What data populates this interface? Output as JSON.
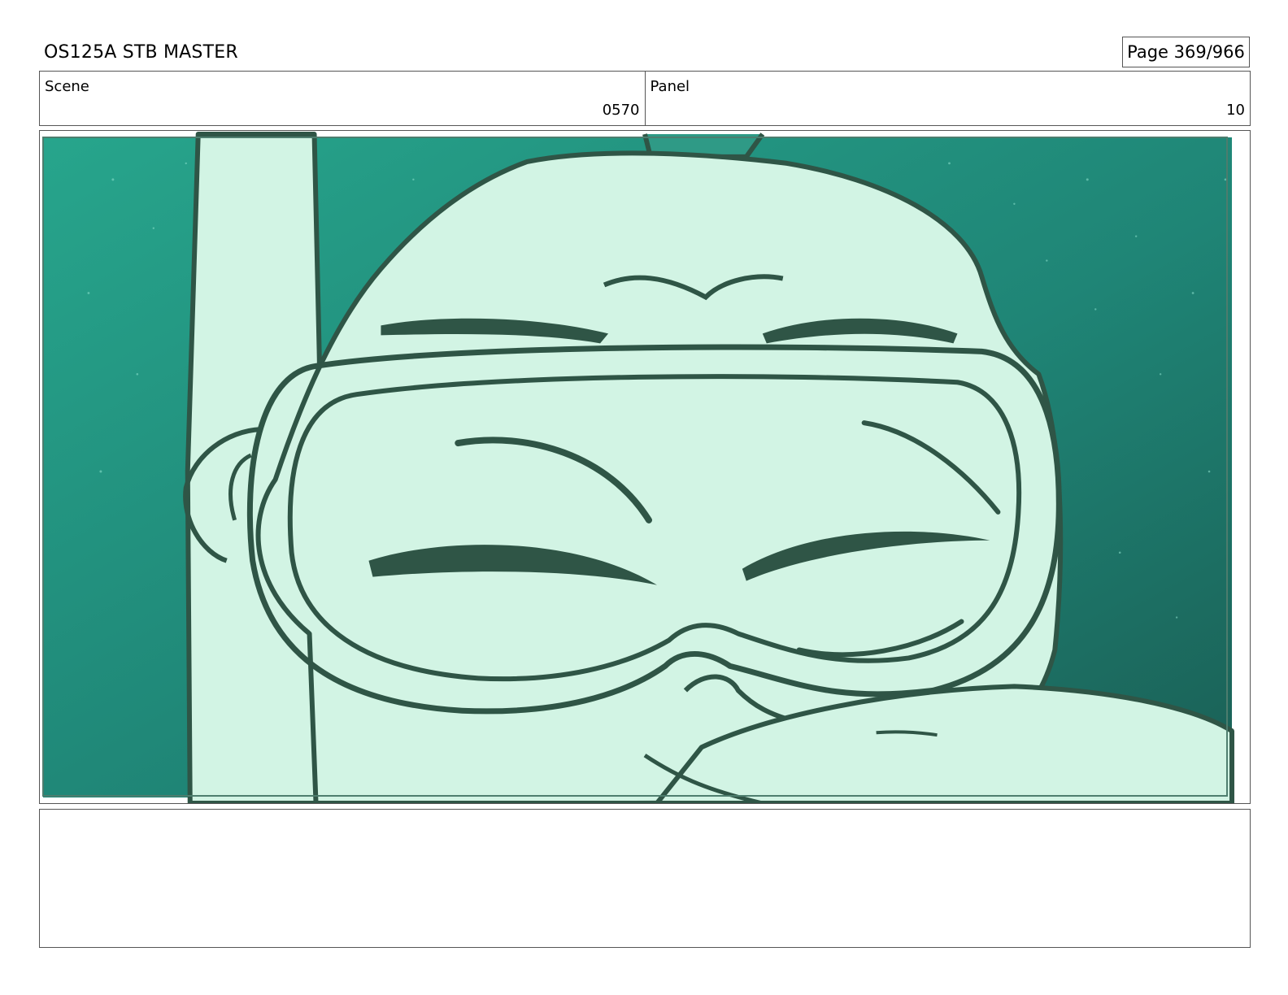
{
  "header": {
    "title": "OS125A STB MASTER",
    "page_label": "Page 369/966"
  },
  "info": {
    "scene_label": "Scene",
    "scene_value": "0570",
    "panel_label": "Panel",
    "panel_value": "10"
  },
  "panel_image": {
    "description_icon": "storyboard-drawing",
    "colors": {
      "water_light": "#27a58c",
      "water_dark": "#1a5f55",
      "skin": "#d2f4e4",
      "ink": "#2f5546"
    }
  },
  "notes": {
    "text": ""
  }
}
